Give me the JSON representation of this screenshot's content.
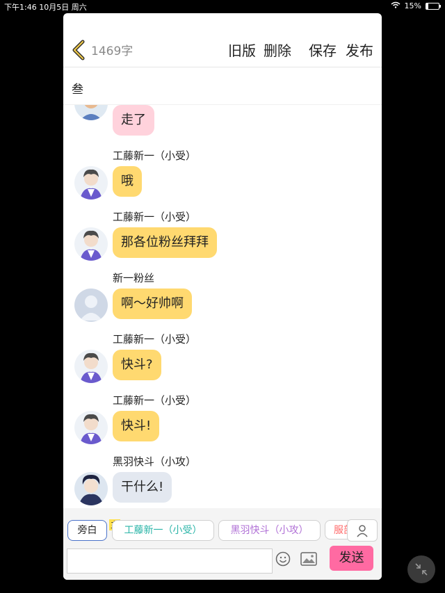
{
  "status_bar": {
    "time_date": "下午1:46   10月5日 周六",
    "battery_percent": "15%",
    "battery_level": 0.15
  },
  "header": {
    "word_count": "1469字",
    "actions": {
      "old_version": "旧版",
      "delete": "删除",
      "save": "保存",
      "publish": "发布"
    }
  },
  "story_title": "叁",
  "messages": [
    {
      "sender": "",
      "text": "走了",
      "color": "#ffd2dc"
    },
    {
      "sender": "工藤新一（小受）",
      "text": "哦",
      "color": "#ffd970"
    },
    {
      "sender": "工藤新一（小受）",
      "text": "那各位粉丝拜拜",
      "color": "#ffd970"
    },
    {
      "sender": "新一粉丝",
      "text": "啊～好帅啊",
      "color": "#ffd970"
    },
    {
      "sender": "工藤新一（小受）",
      "text": "快斗?",
      "color": "#ffd970"
    },
    {
      "sender": "工藤新一（小受）",
      "text": "快斗!",
      "color": "#ffd970"
    },
    {
      "sender": "黑羽快斗（小攻）",
      "text": "干什么!",
      "color": "#e3e8f0"
    }
  ],
  "role_chips": {
    "narration": "旁白",
    "main_badge": "主",
    "role1": "工藤新一（小受）",
    "role2": "黑羽快斗（小攻）",
    "role3": "服部"
  },
  "input": {
    "placeholder": ""
  },
  "send_label": "发送",
  "colors": {
    "chip1": "#2bb5a8",
    "chip2": "#b070d6",
    "chip3": "#ff6a6a",
    "send": "#ff6aa2"
  }
}
